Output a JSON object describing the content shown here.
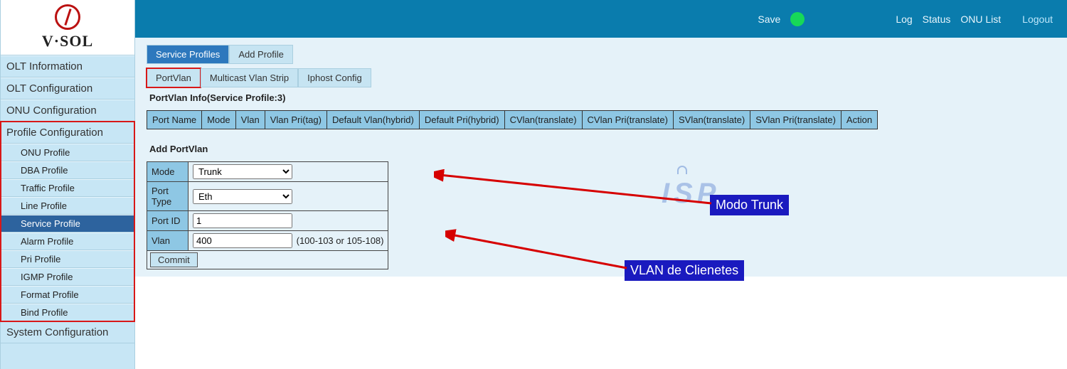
{
  "logo_text": "V·SOL",
  "topbar": {
    "save": "Save",
    "link_log": "Log",
    "link_status": "Status",
    "link_onulist": "ONU List",
    "link_logout": "Logout"
  },
  "sidebar": {
    "items": [
      {
        "label": "OLT Information",
        "type": "group"
      },
      {
        "label": "OLT Configuration",
        "type": "group"
      },
      {
        "label": "ONU Configuration",
        "type": "group"
      },
      {
        "label": "Profile Configuration",
        "type": "group",
        "highlight": true
      },
      {
        "label": "ONU Profile",
        "type": "sub"
      },
      {
        "label": "DBA Profile",
        "type": "sub"
      },
      {
        "label": "Traffic Profile",
        "type": "sub"
      },
      {
        "label": "Line Profile",
        "type": "sub"
      },
      {
        "label": "Service Profile",
        "type": "sub",
        "active": true
      },
      {
        "label": "Alarm Profile",
        "type": "sub"
      },
      {
        "label": "Pri Profile",
        "type": "sub"
      },
      {
        "label": "IGMP Profile",
        "type": "sub"
      },
      {
        "label": "Format Profile",
        "type": "sub"
      },
      {
        "label": "Bind Profile",
        "type": "sub"
      },
      {
        "label": "System Configuration",
        "type": "group"
      }
    ]
  },
  "tabs_primary": [
    "Service Profiles",
    "Add Profile"
  ],
  "tabs_secondary": [
    "PortVlan",
    "Multicast Vlan Strip",
    "Iphost Config"
  ],
  "heading_info": "PortVlan Info(Service Profile:3)",
  "info_cols": [
    "Port Name",
    "Mode",
    "Vlan",
    "Vlan Pri(tag)",
    "Default Vlan(hybrid)",
    "Default Pri(hybrid)",
    "CVlan(translate)",
    "CVlan Pri(translate)",
    "SVlan(translate)",
    "SVlan Pri(translate)",
    "Action"
  ],
  "heading_add": "Add PortVlan",
  "form": {
    "mode_label": "Mode",
    "mode_value": "Trunk",
    "porttype_label": "Port Type",
    "porttype_value": "Eth",
    "portid_label": "Port ID",
    "portid_value": "1",
    "vlan_label": "Vlan",
    "vlan_value": "400",
    "vlan_hint": "(100-103 or 105-108)",
    "commit": "Commit"
  },
  "annotations": {
    "modo_trunk": "Modo Trunk",
    "vlan_clientes": "VLAN de Clienetes"
  }
}
